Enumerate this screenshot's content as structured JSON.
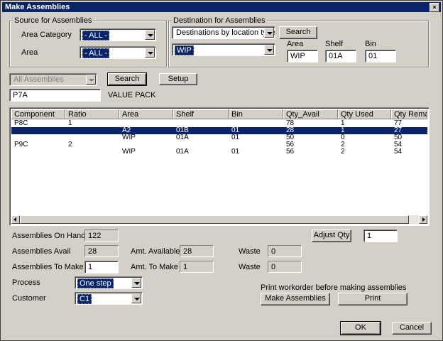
{
  "window": {
    "title": "Make Assemblies",
    "close_glyph": "×"
  },
  "source": {
    "group_title": "Source for Assemblies",
    "area_category_label": "Area Category",
    "area_category_value": "- ALL -",
    "area_label": "Area",
    "area_value": "- ALL -"
  },
  "destination": {
    "group_title": "Destination for Assemblies",
    "mode_value": "Destinations by location type",
    "search_label": "Search",
    "location_value": "WIP",
    "area_label": "Area",
    "area_value": "WIP",
    "shelf_label": "Shelf",
    "shelf_value": "01A",
    "bin_label": "Bin",
    "bin_value": "01"
  },
  "assembly": {
    "filter_value": "All Assemblies",
    "search_label": "Search",
    "setup_label": "Setup",
    "code_value": "P7A",
    "description": "VALUE PACK"
  },
  "grid": {
    "columns": [
      "Component",
      "Ratio",
      "Area",
      "Shelf",
      "Bin",
      "Qty_Avail",
      "Qty Used",
      "Qty Remain"
    ],
    "rows": [
      [
        "P8C",
        "1",
        "",
        "",
        "",
        "78",
        "1",
        "77"
      ],
      [
        "",
        "",
        "A2",
        "01B",
        "01",
        "28",
        "1",
        "27"
      ],
      [
        "",
        "",
        "WIP",
        "01A",
        "01",
        "50",
        "0",
        "50"
      ],
      [
        "P9C",
        "2",
        "",
        "",
        "",
        "56",
        "2",
        "54"
      ],
      [
        "",
        "",
        "WIP",
        "01A",
        "01",
        "56",
        "2",
        "54"
      ]
    ],
    "selected_row": 1
  },
  "stats": {
    "on_hand_label": "Assemblies On Hand",
    "on_hand_value": "122",
    "avail_label": "Assemblies Avail",
    "avail_value": "28",
    "to_make_label": "Assemblies To Make",
    "to_make_value": "1",
    "amt_available_label": "Amt. Available",
    "amt_available_value": "28",
    "amt_to_make_label": "Amt. To Make",
    "amt_to_make_value": "1",
    "waste_label_1": "Waste",
    "waste_value_1": "0",
    "waste_label_2": "Waste",
    "waste_value_2": "0",
    "adjust_qty_label": "Adjust Qty",
    "adjust_qty_value": "1"
  },
  "process": {
    "label": "Process",
    "value": "One step"
  },
  "customer": {
    "label": "Customer",
    "value": "C1"
  },
  "print": {
    "caption": "Print workorder before making assemblies",
    "make_label": "Make Assemblies",
    "print_label": "Print"
  },
  "footer": {
    "ok_label": "OK",
    "cancel_label": "Cancel"
  }
}
